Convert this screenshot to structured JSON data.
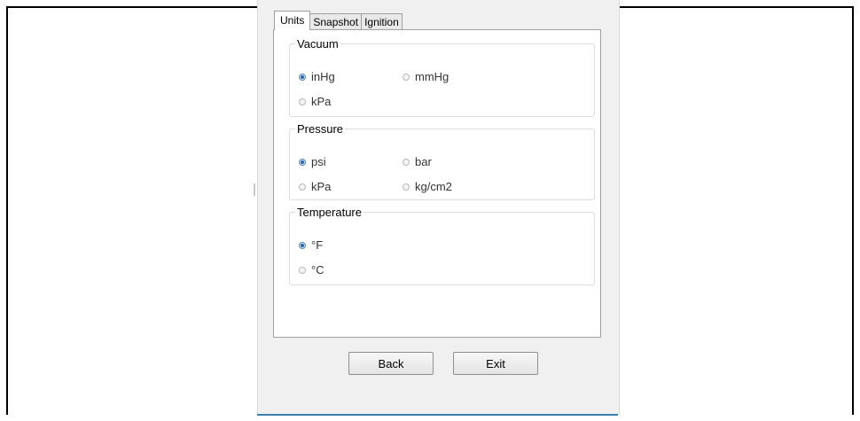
{
  "tabs": [
    {
      "label": "Units",
      "active": true
    },
    {
      "label": "Snapshot",
      "active": false
    },
    {
      "label": "Ignition",
      "active": false
    }
  ],
  "groups": {
    "vacuum": {
      "title": "Vacuum",
      "options": [
        {
          "label": "inHg",
          "selected": true
        },
        {
          "label": "mmHg",
          "selected": false
        },
        {
          "label": "kPa",
          "selected": false
        }
      ]
    },
    "pressure": {
      "title": "Pressure",
      "options": [
        {
          "label": "psi",
          "selected": true
        },
        {
          "label": "bar",
          "selected": false
        },
        {
          "label": "kPa",
          "selected": false
        },
        {
          "label": "kg/cm2",
          "selected": false
        }
      ]
    },
    "temperature": {
      "title": "Temperature",
      "options": [
        {
          "label": "°F",
          "selected": true
        },
        {
          "label": "°C",
          "selected": false
        }
      ]
    }
  },
  "buttons": {
    "back": "Back",
    "exit": "Exit"
  },
  "colors": {
    "accent": "#2a62a8",
    "panel_border": "#a0a0a0",
    "window_bg": "#f0f0f0"
  }
}
